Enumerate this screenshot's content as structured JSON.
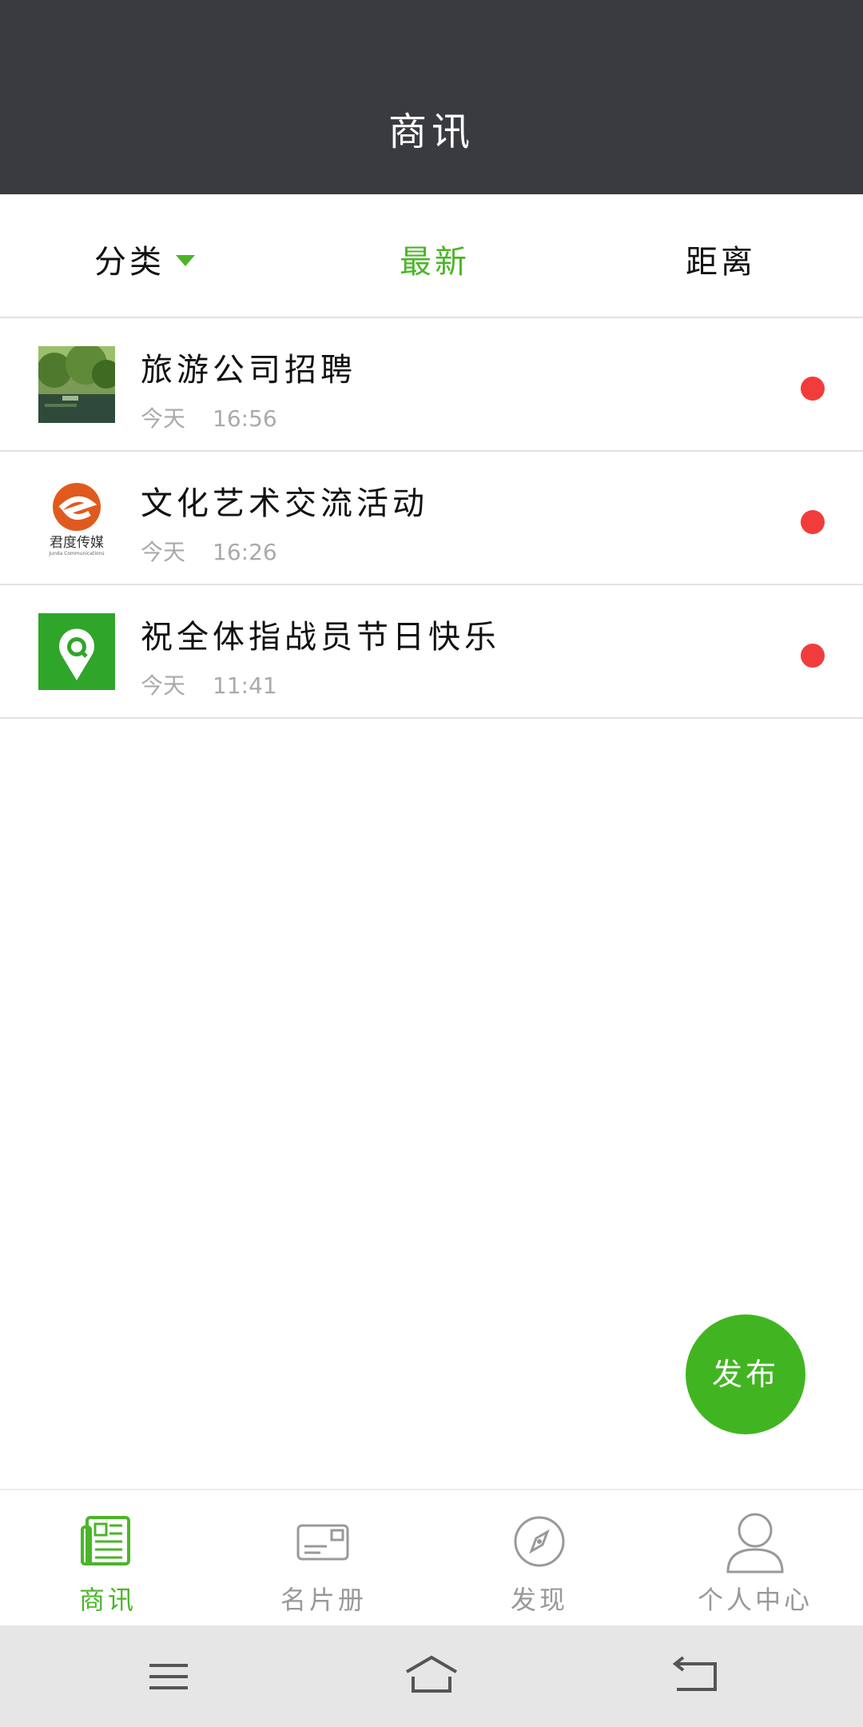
{
  "header": {
    "title": "商讯"
  },
  "filter": {
    "category_label": "分类",
    "latest_label": "最新",
    "distance_label": "距离"
  },
  "news_items": [
    {
      "title": "旅游公司招聘",
      "day": "今天",
      "time": "16:56",
      "thumb_icon": "landscape-photo"
    },
    {
      "title": "文化艺术交流活动",
      "day": "今天",
      "time": "16:26",
      "thumb_icon": "junshi-media-logo"
    },
    {
      "title": "祝全体指战员节日快乐",
      "day": "今天",
      "time": "11:41",
      "thumb_icon": "location-search-logo"
    }
  ],
  "logo_text": {
    "brand_cn": "君度传媒",
    "brand_en": "Junda Communications"
  },
  "fab": {
    "label": "发布"
  },
  "tabbar": {
    "items": [
      {
        "label": "商讯",
        "icon": "newspaper-icon"
      },
      {
        "label": "名片册",
        "icon": "card-icon"
      },
      {
        "label": "发现",
        "icon": "compass-icon"
      },
      {
        "label": "个人中心",
        "icon": "person-icon"
      }
    ]
  },
  "colors": {
    "accent": "#4bb528",
    "header_bg": "#3a3b40",
    "unread_dot": "#f23c3c"
  }
}
